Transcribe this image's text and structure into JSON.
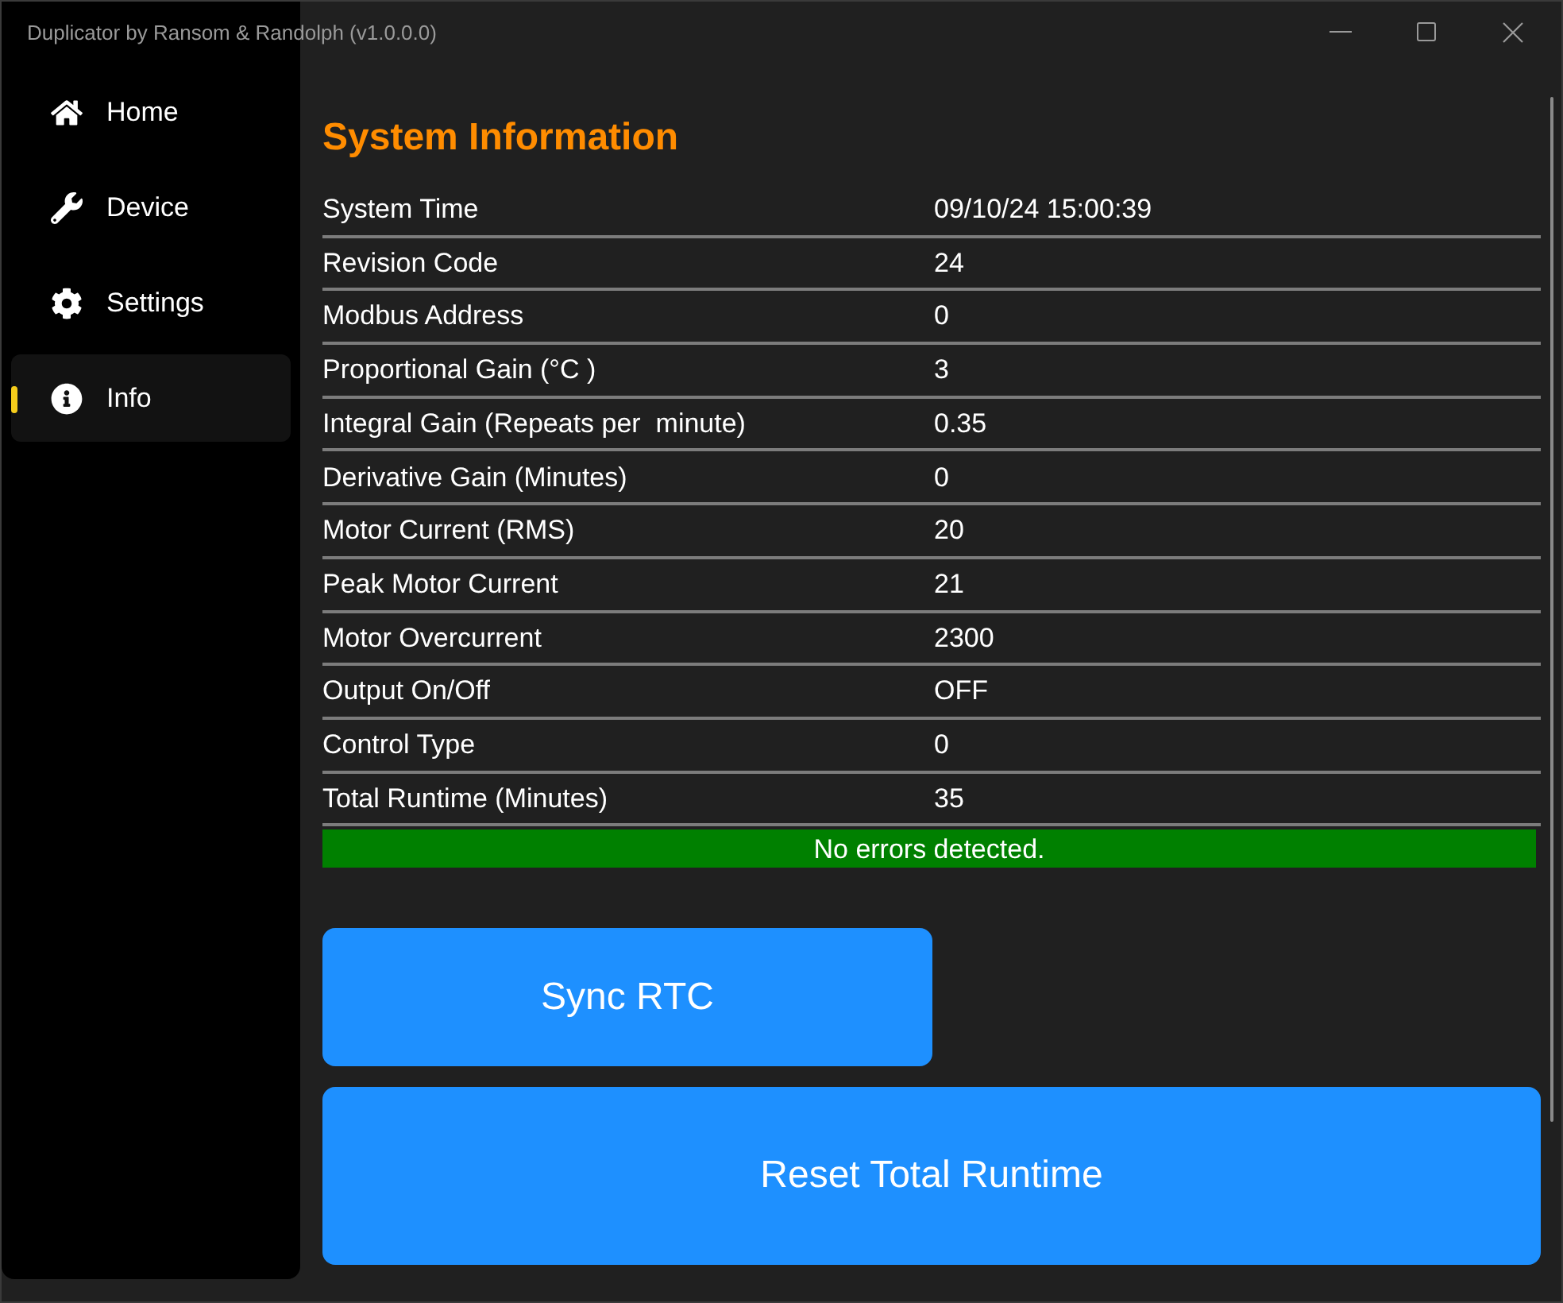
{
  "window": {
    "title": "Duplicator by Ransom & Randolph (v1.0.0.0)"
  },
  "sidebar": {
    "items": [
      {
        "label": "Home",
        "selected": false
      },
      {
        "label": "Device",
        "selected": false
      },
      {
        "label": "Settings",
        "selected": false
      },
      {
        "label": "Info",
        "selected": true
      }
    ]
  },
  "page": {
    "title": "System Information",
    "rows": [
      {
        "label": "System Time",
        "value": "09/10/24 15:00:39"
      },
      {
        "label": "Revision Code",
        "value": "24"
      },
      {
        "label": "Modbus Address",
        "value": "0"
      },
      {
        "label": "Proportional Gain (°C )",
        "value": "3"
      },
      {
        "label": "Integral Gain (Repeats per  minute)",
        "value": "0.35"
      },
      {
        "label": "Derivative Gain (Minutes)",
        "value": "0"
      },
      {
        "label": "Motor Current (RMS)",
        "value": "20"
      },
      {
        "label": "Peak Motor Current",
        "value": "21"
      },
      {
        "label": "Motor Overcurrent",
        "value": "2300"
      },
      {
        "label": "Output On/Off",
        "value": "OFF"
      },
      {
        "label": "Control Type",
        "value": "0"
      },
      {
        "label": "Total Runtime (Minutes)",
        "value": "35"
      }
    ],
    "status": {
      "text": "No errors detected.",
      "kind": "ok"
    },
    "sync_button": {
      "label": "Sync RTC"
    },
    "reset_button": {
      "label": "Reset Total Runtime"
    }
  }
}
